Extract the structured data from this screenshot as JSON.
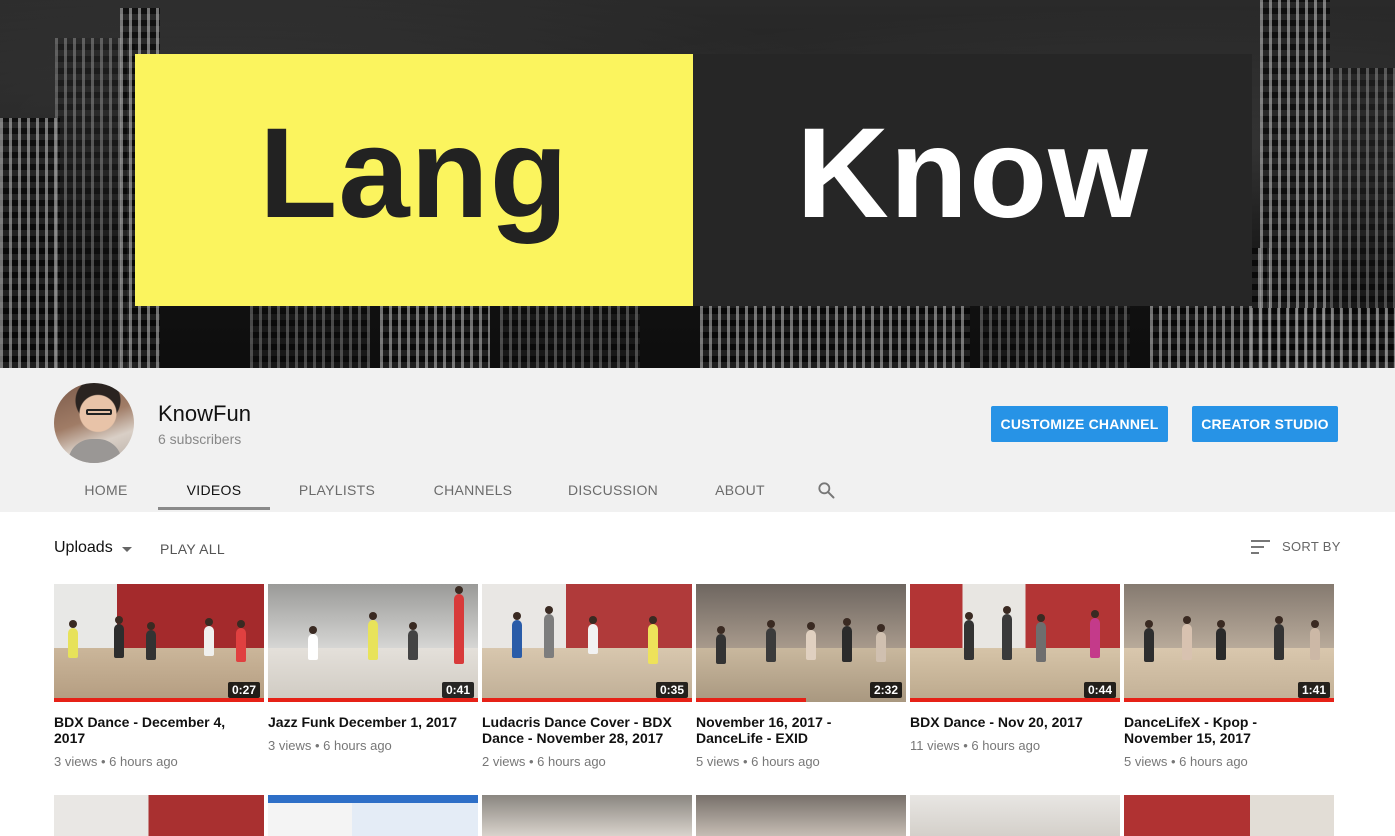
{
  "banner": {
    "logo_left": "Lang",
    "logo_right": "Know",
    "colors": {
      "yellow": "#fbf45e",
      "dark": "#262626"
    }
  },
  "channel": {
    "name": "KnowFun",
    "subscribers": "6 subscribers"
  },
  "actions": {
    "customize": "CUSTOMIZE CHANNEL",
    "studio": "CREATOR STUDIO",
    "accent": "#2793e6"
  },
  "tabs": [
    {
      "label": "HOME"
    },
    {
      "label": "VIDEOS"
    },
    {
      "label": "PLAYLISTS"
    },
    {
      "label": "CHANNELS"
    },
    {
      "label": "DISCUSSION"
    },
    {
      "label": "ABOUT"
    }
  ],
  "active_tab": "VIDEOS",
  "toolbar": {
    "uploads_label": "Uploads",
    "play_all": "PLAY ALL",
    "sort_by": "SORT BY"
  },
  "videos": [
    {
      "title": "BDX Dance - December 4, 2017",
      "duration": "0:27",
      "meta": "3 views • 6 hours ago"
    },
    {
      "title": "Jazz Funk December 1, 2017",
      "duration": "0:41",
      "meta": "3 views • 6 hours ago"
    },
    {
      "title": "Ludacris Dance Cover - BDX Dance - November 28, 2017",
      "duration": "0:35",
      "meta": "2 views • 6 hours ago"
    },
    {
      "title": "November 16, 2017 - DanceLife - EXID",
      "duration": "2:32",
      "meta": "5 views • 6 hours ago"
    },
    {
      "title": "BDX Dance - Nov 20, 2017",
      "duration": "0:44",
      "meta": "11 views • 6 hours ago"
    },
    {
      "title": "DanceLifeX - Kpop - November 15, 2017",
      "duration": "1:41",
      "meta": "5 views • 6 hours ago"
    }
  ],
  "icons": {
    "search": "search-icon",
    "sort": "sort-icon",
    "dropdown": "chevron-down-icon"
  }
}
